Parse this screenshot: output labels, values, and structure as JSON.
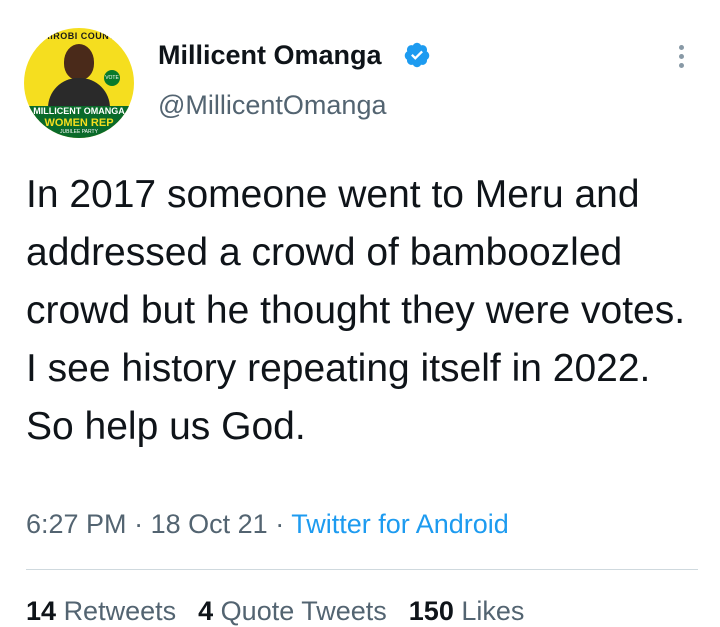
{
  "profile": {
    "name": "Millicent Omanga",
    "handle": "@MillicentOmanga",
    "avatar": {
      "top_text": "NAIROBI COUNTY",
      "banner_line1": "MILLICENT OMANGA",
      "banner_line2": "WOMEN REP",
      "banner_line3": "JUBILEE PARTY",
      "badge_text": "VOTE"
    },
    "verified_icon": "verified-badge-icon",
    "accent": "#1d9bf0"
  },
  "tweet": {
    "text": "In 2017 someone went to Meru and addressed a crowd of bamboozled crowd but he thought they were votes. I see history repeating itself in 2022. So help us God."
  },
  "meta": {
    "time": "6:27 PM",
    "separator": "·",
    "date": "18 Oct 21",
    "source": "Twitter for Android"
  },
  "stats": {
    "retweets_count": "14",
    "retweets_label": "Retweets",
    "quotes_count": "4",
    "quotes_label": "Quote Tweets",
    "likes_count": "150",
    "likes_label": "Likes"
  }
}
